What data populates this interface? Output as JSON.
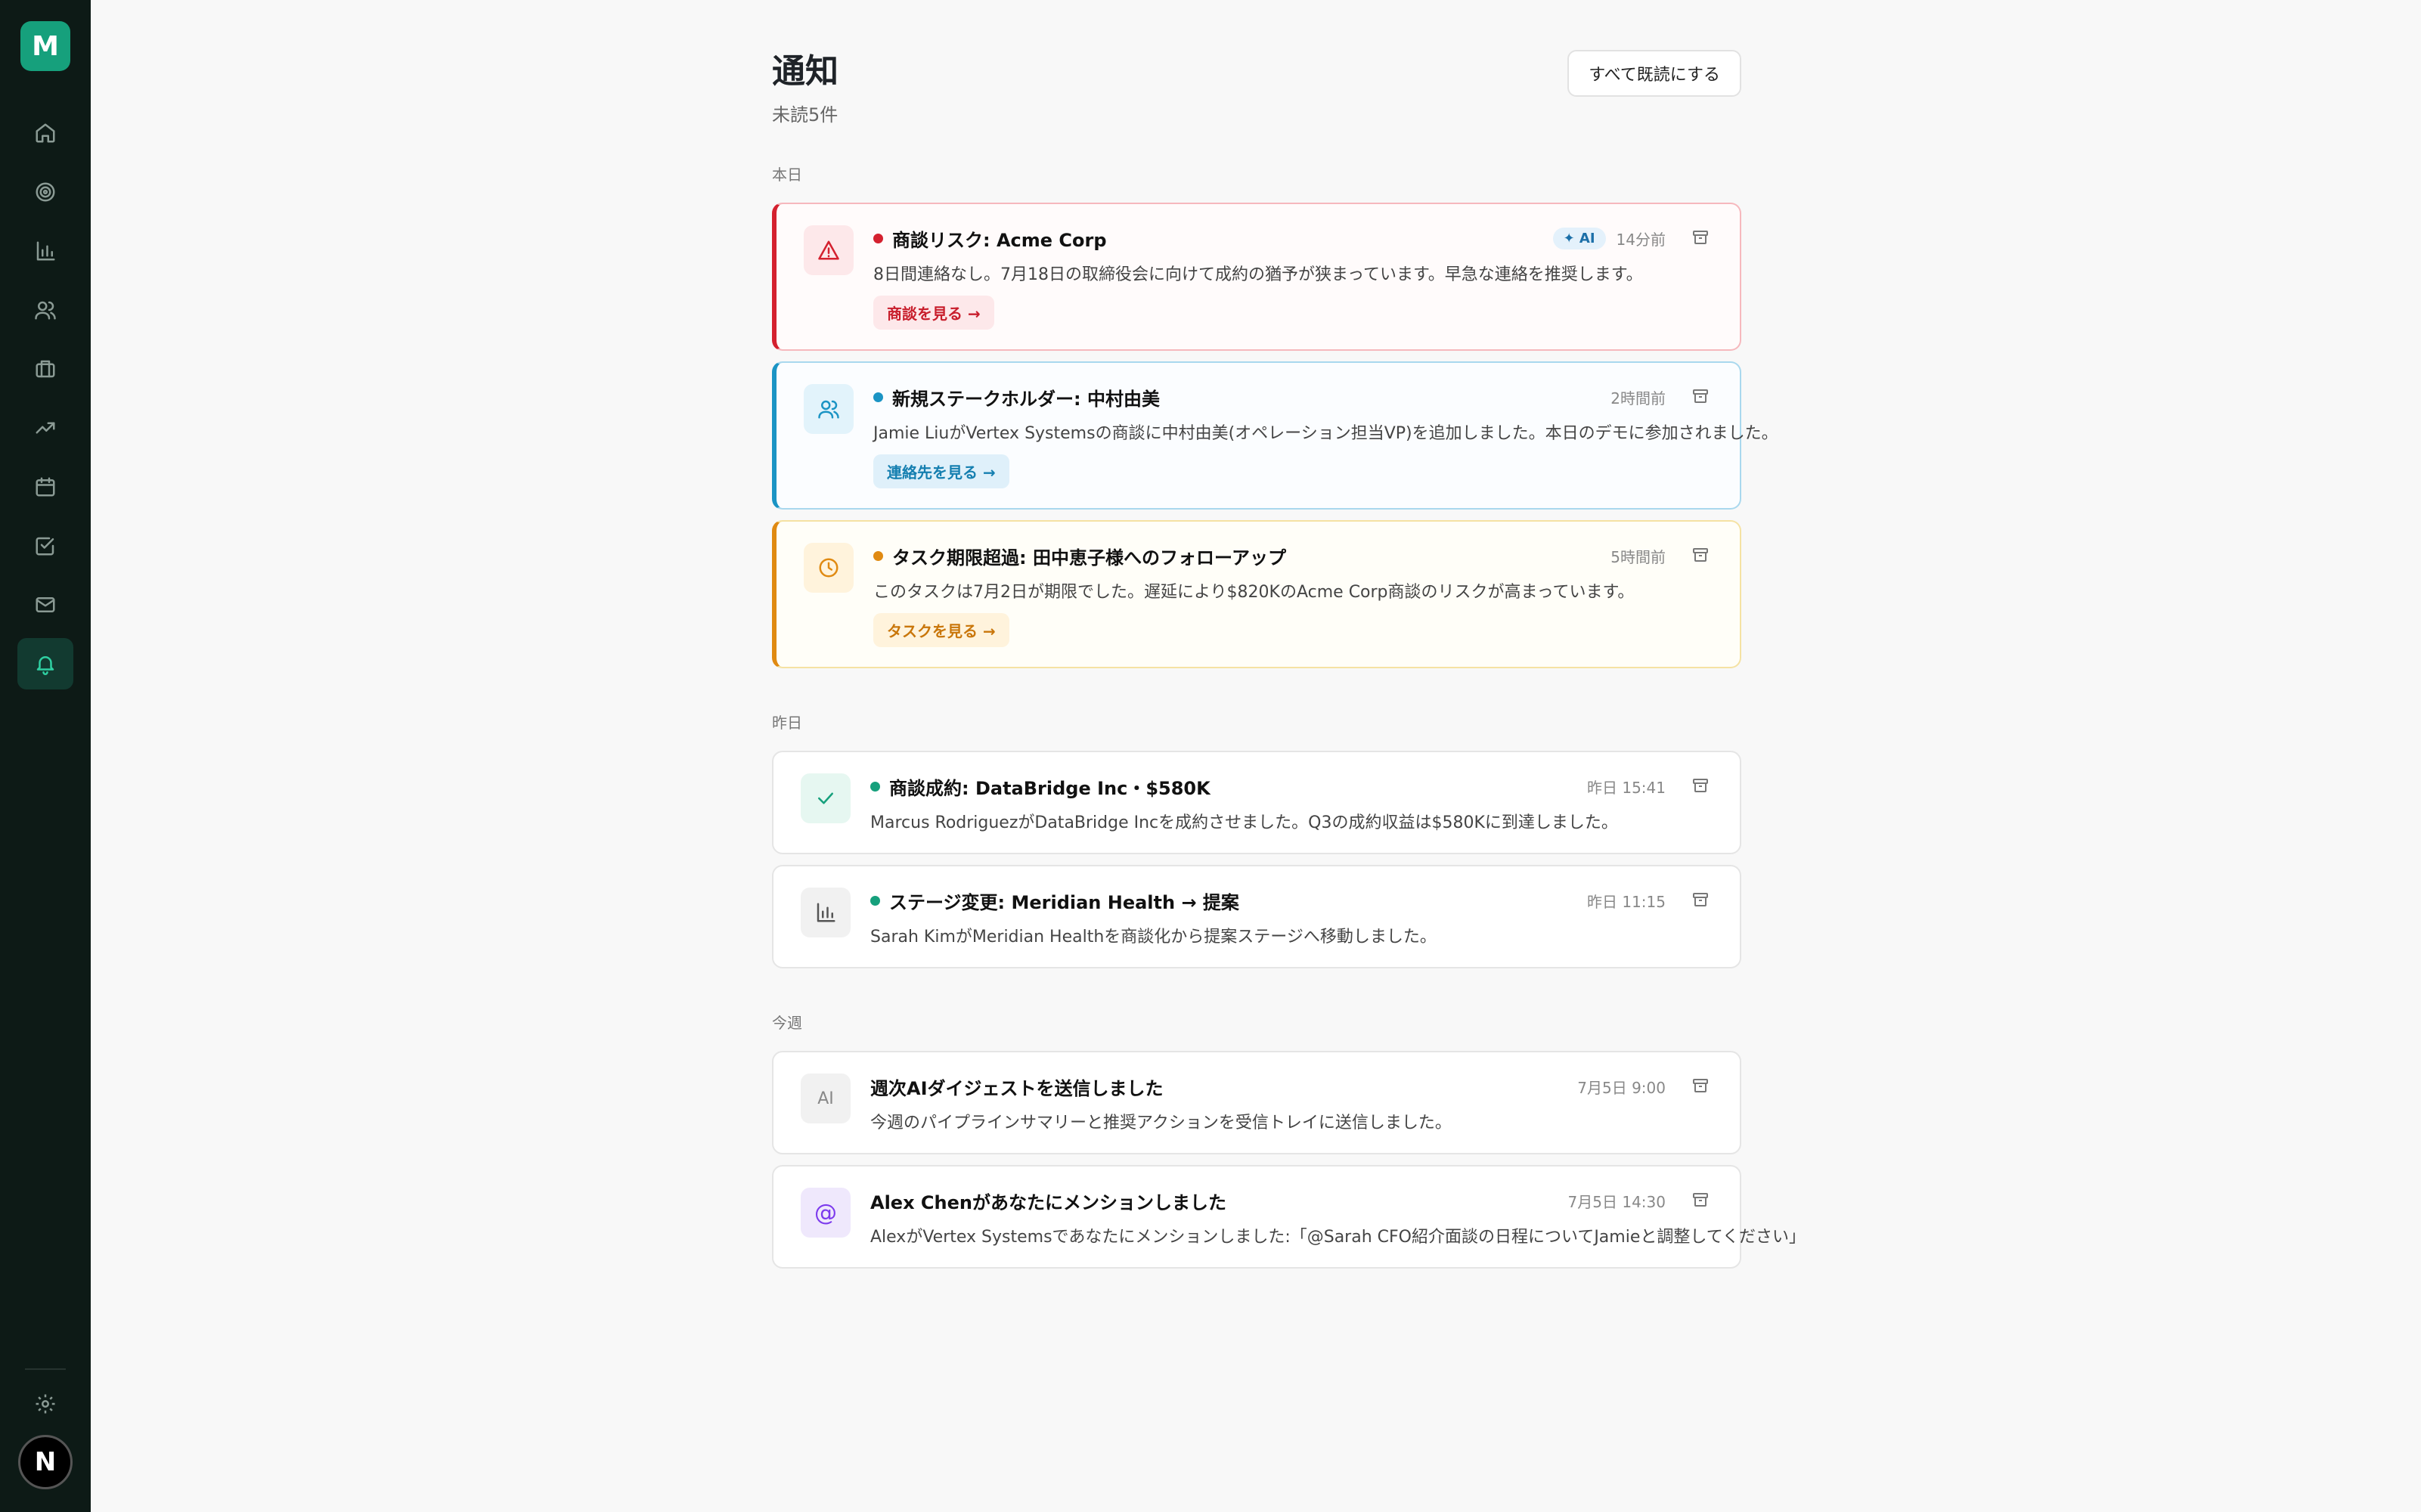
{
  "app": {
    "logo_letter": "M",
    "avatar_letter": "N"
  },
  "header": {
    "title": "通知",
    "unread": "未読5件",
    "mark_all_read": "すべて既読にする"
  },
  "sections": {
    "today": "本日",
    "yesterday": "昨日",
    "this_week": "今週"
  },
  "notifications": [
    {
      "title": "商談リスク: Acme Corp",
      "badge": "✦ AI",
      "time": "14分前",
      "body": "8日間連絡なし。7月18日の取締役会に向けて成約の猶予が狭まっています。早急な連絡を推奨します。",
      "action": "商談を見る →"
    },
    {
      "title": "新規ステークホルダー: 中村由美",
      "time": "2時間前",
      "body": "Jamie LiuがVertex Systemsの商談に中村由美(オペレーション担当VP)を追加しました。本日のデモに参加されました。",
      "action": "連絡先を見る →"
    },
    {
      "title": "タスク期限超過: 田中恵子様へのフォローアップ",
      "time": "5時間前",
      "body": "このタスクは7月2日が期限でした。遅延により$820KのAcme Corp商談のリスクが高まっています。",
      "action": "タスクを見る →"
    },
    {
      "title": "商談成約: DataBridge Inc・$580K",
      "time": "昨日 15:41",
      "body": "Marcus RodriguezがDataBridge Incを成約させました。Q3の成約収益は$580Kに到達しました。"
    },
    {
      "title": "ステージ変更: Meridian Health → 提案",
      "time": "昨日 11:15",
      "body": "Sarah KimがMeridian Healthを商談化から提案ステージへ移動しました。"
    },
    {
      "icon_text": "AI",
      "title": "週次AIダイジェストを送信しました",
      "time": "7月5日 9:00",
      "body": "今週のパイプラインサマリーと推奨アクションを受信トレイに送信しました。"
    },
    {
      "icon_text": "@",
      "title": "Alex Chenがあなたにメンションしました",
      "time": "7月5日 14:30",
      "body": "AlexがVertex Systemsであなたにメンションしました:「@Sarah CFO紹介面談の日程についてJamieと調整してください」"
    }
  ],
  "colors": {
    "sidebar": "#0d1a16",
    "brand": "#16a07c",
    "risk": "#d4212f",
    "info": "#1b94c4",
    "warning": "#e08a12"
  }
}
